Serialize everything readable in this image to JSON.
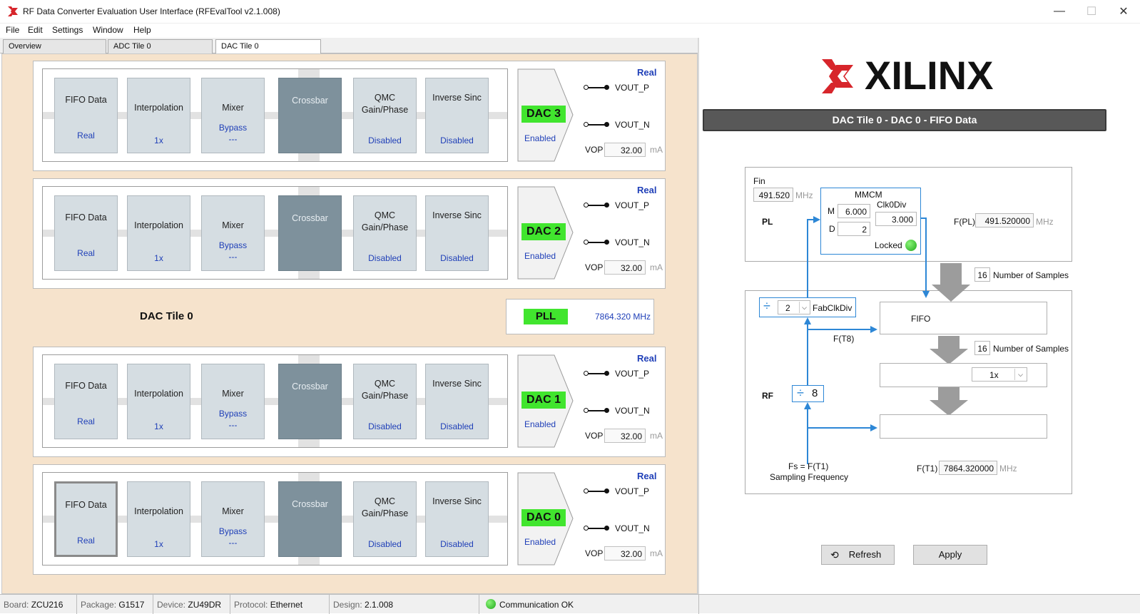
{
  "window": {
    "title": "RF Data Converter Evaluation User Interface (RFEvalTool v2.1.008)",
    "minimize": "—",
    "maximize": "☐",
    "close": "✕"
  },
  "menu": [
    "File",
    "Edit",
    "Settings",
    "Window",
    "Help"
  ],
  "tabs": [
    "Overview",
    "ADC Tile 0",
    "DAC Tile 0"
  ],
  "active_tab": "DAC Tile 0",
  "tile_label": "DAC Tile 0",
  "pll": {
    "label": "PLL",
    "freq": "7864.320 MHz"
  },
  "dacs": [
    {
      "name": "DAC 3",
      "mode": "Real",
      "fifo_title": "FIFO Data",
      "fifo_value": "Real",
      "interp_title": "Interpolation",
      "interp_value": "1x",
      "mixer_title": "Mixer",
      "mixer_value1": "Bypass",
      "mixer_value2": "---",
      "crossbar": "Crossbar",
      "qmc_title": "QMC Gain/Phase",
      "qmc_value": "Disabled",
      "sinc_title": "Inverse Sinc",
      "sinc_value": "Disabled",
      "status": "Enabled",
      "vout_p": "VOUT_P",
      "vout_n": "VOUT_N",
      "vop_label": "VOP",
      "vop": "32.00",
      "vop_unit": "mA"
    },
    {
      "name": "DAC 2",
      "mode": "Real",
      "fifo_title": "FIFO Data",
      "fifo_value": "Real",
      "interp_title": "Interpolation",
      "interp_value": "1x",
      "mixer_title": "Mixer",
      "mixer_value1": "Bypass",
      "mixer_value2": "---",
      "crossbar": "Crossbar",
      "qmc_title": "QMC Gain/Phase",
      "qmc_value": "Disabled",
      "sinc_title": "Inverse Sinc",
      "sinc_value": "Disabled",
      "status": "Enabled",
      "vout_p": "VOUT_P",
      "vout_n": "VOUT_N",
      "vop_label": "VOP",
      "vop": "32.00",
      "vop_unit": "mA"
    },
    {
      "name": "DAC 1",
      "mode": "Real",
      "fifo_title": "FIFO Data",
      "fifo_value": "Real",
      "interp_title": "Interpolation",
      "interp_value": "1x",
      "mixer_title": "Mixer",
      "mixer_value1": "Bypass",
      "mixer_value2": "---",
      "crossbar": "Crossbar",
      "qmc_title": "QMC Gain/Phase",
      "qmc_value": "Disabled",
      "sinc_title": "Inverse Sinc",
      "sinc_value": "Disabled",
      "status": "Enabled",
      "vout_p": "VOUT_P",
      "vout_n": "VOUT_N",
      "vop_label": "VOP",
      "vop": "32.00",
      "vop_unit": "mA"
    },
    {
      "name": "DAC 0",
      "mode": "Real",
      "fifo_title": "FIFO Data",
      "fifo_value": "Real",
      "interp_title": "Interpolation",
      "interp_value": "1x",
      "mixer_title": "Mixer",
      "mixer_value1": "Bypass",
      "mixer_value2": "---",
      "crossbar": "Crossbar",
      "qmc_title": "QMC Gain/Phase",
      "qmc_value": "Disabled",
      "sinc_title": "Inverse Sinc",
      "sinc_value": "Disabled",
      "status": "Enabled",
      "vout_p": "VOUT_P",
      "vout_n": "VOUT_N",
      "vop_label": "VOP",
      "vop": "32.00",
      "vop_unit": "mA"
    }
  ],
  "right": {
    "logo_text": "XILINX",
    "panel_title": "DAC Tile 0 - DAC 0 - FIFO Data",
    "fin_label": "Fin",
    "fin_value": "491.520",
    "fin_unit": "MHz",
    "pl_label": "PL",
    "rf_label": "RF",
    "mmcm_label": "MMCM",
    "m_label": "M",
    "m_value": "6.000",
    "d_label": "D",
    "d_value": "2",
    "clk0div_label": "Clk0Div",
    "clk0div_value": "3.000",
    "locked_label": "Locked",
    "fpl_label": "F(PL)",
    "fpl_value": "491.520000",
    "fpl_unit": "MHz",
    "samples1_value": "16",
    "samples_label": "Number of Samples",
    "samples2_value": "16",
    "fabclkdiv_value": "2",
    "fabclkdiv_label": "FabClkDiv",
    "ft8_label": "F(T8)",
    "fifo_label": "FIFO",
    "interp_select": "1x",
    "div8_value": "8",
    "fs_label1": "Fs = F(T1)",
    "fs_label2": "Sampling Frequency",
    "ft1_label": "F(T1)",
    "ft1_value": "7864.320000",
    "ft1_unit": "MHz",
    "refresh_label": "Refresh",
    "apply_label": "Apply"
  },
  "status": {
    "board_k": "Board:",
    "board": "ZCU216",
    "package_k": "Package:",
    "package": "G1517",
    "device_k": "Device:",
    "device": "ZU49DR",
    "protocol_k": "Protocol:",
    "protocol": "Ethernet",
    "design_k": "Design:",
    "design": "2.1.008",
    "comm": "Communication OK"
  },
  "colors": {
    "accent_green": "#41e52e",
    "link_blue": "#2040b8",
    "line_blue": "#2d87d6",
    "xilinx_red": "#d7252b"
  }
}
